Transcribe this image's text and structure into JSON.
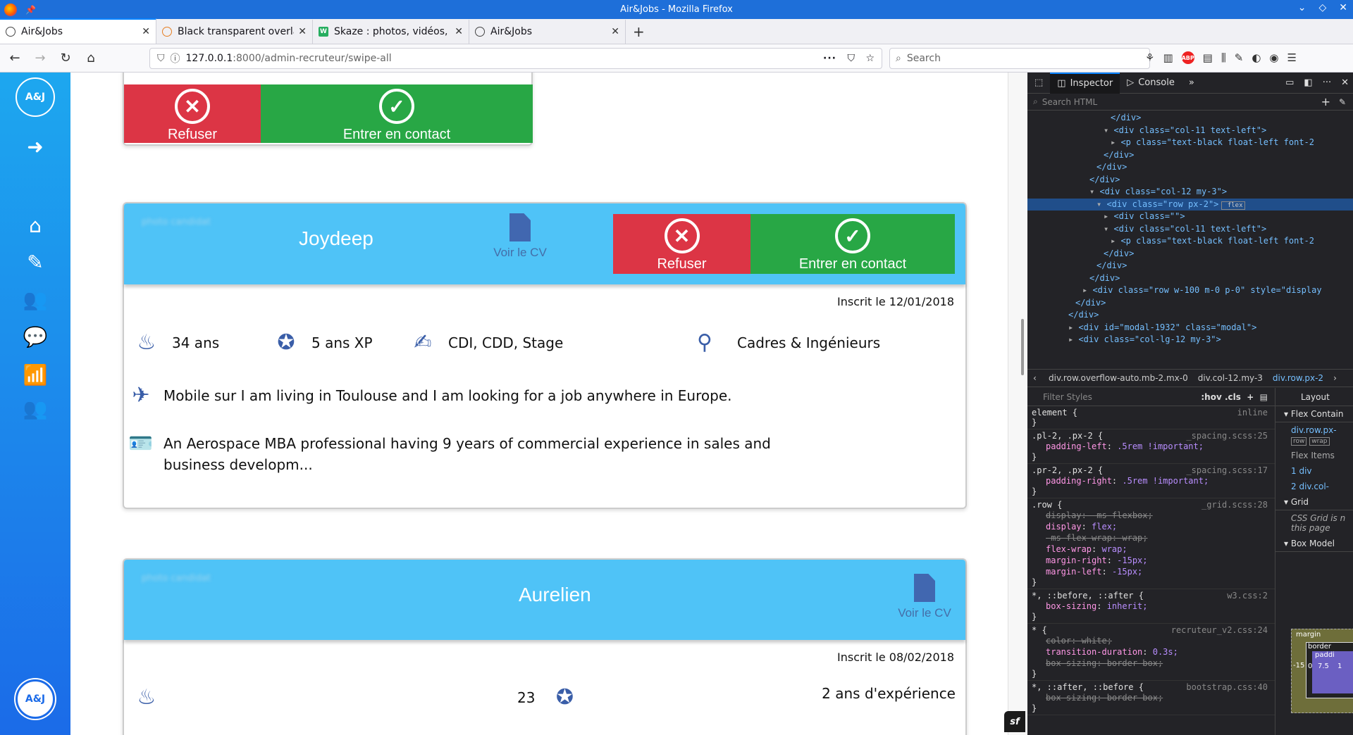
{
  "window": {
    "title": "Air&Jobs - Mozilla Firefox"
  },
  "tabs": [
    {
      "label": "Air&Jobs",
      "active": true
    },
    {
      "label": "Black transparent overla",
      "active": false
    },
    {
      "label": "Skaze : photos, vidéos, r",
      "active": false
    },
    {
      "label": "Air&Jobs",
      "active": false
    }
  ],
  "nav": {
    "url_host": "127.0.0.1",
    "url_rest": ":8000/admin-recruteur/swipe-all",
    "search_placeholder": "Search"
  },
  "sidebar": {
    "logo": "A&J",
    "items": [
      "logout-icon",
      "home-icon",
      "edit-icon",
      "users-icon",
      "chat-icon",
      "stats-icon",
      "team-icon"
    ],
    "bottom_logo": "A&J"
  },
  "cards": [
    {
      "buttons": {
        "refuse": "Refuser",
        "contact": "Entrer en contact"
      }
    },
    {
      "blur_label": "photo candidat",
      "name": "Joydeep",
      "cv_label": "Voir le CV",
      "buttons": {
        "refuse": "Refuser",
        "contact": "Entrer en contact"
      },
      "inscrit": "Inscrit le 12/01/2018",
      "age": "34 ans",
      "xp": "5 ans XP",
      "contracts": "CDI, CDD, Stage",
      "level": "Cadres & Ingénieurs",
      "mobility": "Mobile sur I am living in Toulouse and I am looking for a job anywhere in Europe.",
      "about": "An Aerospace MBA professional having 9 years of commercial experience in sales and business developm..."
    },
    {
      "blur_label": "photo candidat",
      "name": "Aurelien",
      "cv_label": "Voir le CV",
      "inscrit": "Inscrit le 08/02/2018",
      "age": "23",
      "xp": "2 ans d'expérience"
    }
  ],
  "devtools": {
    "tabs": [
      "Inspector",
      "Console"
    ],
    "search_placeholder": "Search HTML",
    "html_lines": [
      "</div>",
      "<div class=\"col-11 text-left\">",
      "<p class=\"text-black float-left font-2",
      "</div>",
      "</div>",
      "</div>",
      "<div class=\"col-12 my-3\">",
      "<div class=\"row px-2\">",
      "<div class=\"\">",
      "<div class=\"col-11 text-left\">",
      "<p class=\"text-black float-left font-2",
      "</div>",
      "</div>",
      "</div>",
      "<div class=\"row w-100 m-0 p-0\" style=\"display",
      "</div>",
      "</div>",
      "<div id=\"modal-1932\" class=\"modal\">",
      "<div class=\"col-lg-12 my-3\">"
    ],
    "html_badge": "flex",
    "crumbs": [
      "div.row.overflow-auto.mb-2.mx-0",
      "div.col-12.my-3",
      "div.row.px-2"
    ],
    "filter_placeholder": "Filter Styles",
    "filter_tools": ":hov .cls",
    "layout_tab": "Layout",
    "layout_sections": [
      "Flex Contain",
      "div.row.px-",
      "Flex Items",
      "1 div",
      "2 div.col-",
      "Grid",
      "CSS Grid is n this page",
      "Box Model"
    ],
    "layout_tags": [
      "row",
      "wrap"
    ],
    "boxmodel": {
      "label": "margin",
      "border_label": "border",
      "padding_label": "paddi",
      "left_value": "-15",
      "value1": "0",
      "value2": "7.5",
      "value3": "1"
    },
    "rules": [
      {
        "selector": "element {",
        "source": "inline",
        "props": []
      },
      {
        "selector": ".pl-2, .px-2 {",
        "source": "_spacing.scss:25",
        "props": [
          [
            "padding-left",
            ".5rem !important;",
            false
          ]
        ]
      },
      {
        "selector": ".pr-2, .px-2 {",
        "source": "_spacing.scss:17",
        "props": [
          [
            "padding-right",
            ".5rem !important;",
            false
          ]
        ]
      },
      {
        "selector": ".row {",
        "source": "_grid.scss:28",
        "props": [
          [
            "display",
            "-ms-flexbox;",
            true
          ],
          [
            "display",
            "flex;",
            false
          ],
          [
            "-ms-flex-wrap",
            "wrap;",
            true
          ],
          [
            "flex-wrap",
            "wrap;",
            false
          ],
          [
            "margin-right",
            "-15px;",
            false
          ],
          [
            "margin-left",
            "-15px;",
            false
          ]
        ]
      },
      {
        "selector": "*, ::before, ::after {",
        "source": "w3.css:2",
        "props": [
          [
            "box-sizing",
            "inherit;",
            false
          ]
        ]
      },
      {
        "selector": "* {",
        "source": "recruteur_v2.css:24",
        "props": [
          [
            "color",
            "white;",
            true
          ],
          [
            "transition-duration",
            "0.3s;",
            false
          ],
          [
            "box-sizing",
            "border-box;",
            true
          ]
        ]
      },
      {
        "selector": "*, ::after, ::before {",
        "source": "bootstrap.css:40",
        "props": [
          [
            "box-sizing",
            "border-box;",
            true
          ]
        ]
      }
    ]
  },
  "colors": {
    "accent": "#4fc3f7",
    "refuse": "#dc3545",
    "contact": "#28a745"
  }
}
